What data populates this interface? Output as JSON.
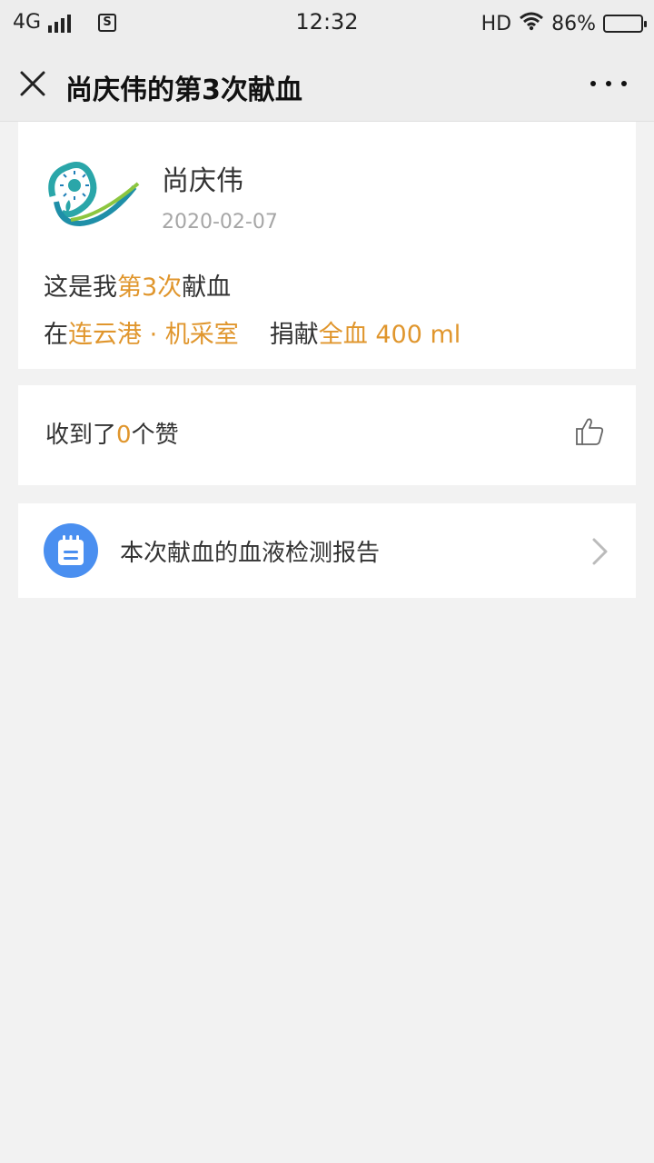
{
  "status_bar": {
    "network": "4G",
    "sim_label": "S",
    "time": "12:32",
    "hd": "HD",
    "battery_percent_text": "86%",
    "battery_level": 0.86
  },
  "nav": {
    "title": "尚庆伟的第3次献血"
  },
  "donation": {
    "user_name": "尚庆伟",
    "date": "2020-02-07",
    "line1_prefix": "这是我",
    "line1_highlight": "第3次",
    "line1_suffix": "献血",
    "line2_prefix": "在",
    "location": "连云港 · 机采室",
    "donate_label": "捐献",
    "blood_type": "全血",
    "amount": " 400 ml"
  },
  "likes": {
    "prefix": "收到了",
    "count": "0",
    "suffix": "个赞"
  },
  "report": {
    "label": "本次献血的血液检测报告"
  },
  "colors": {
    "accent": "#e0962d",
    "report_icon_bg": "#4a8ff0",
    "page_bg": "#f2f2f2"
  },
  "icons": {
    "close": "close-icon",
    "more": "more-icon",
    "logo": "blood-donation-logo",
    "thumb": "thumbs-up-icon",
    "report": "calendar-report-icon",
    "chevron": "chevron-right-icon"
  }
}
